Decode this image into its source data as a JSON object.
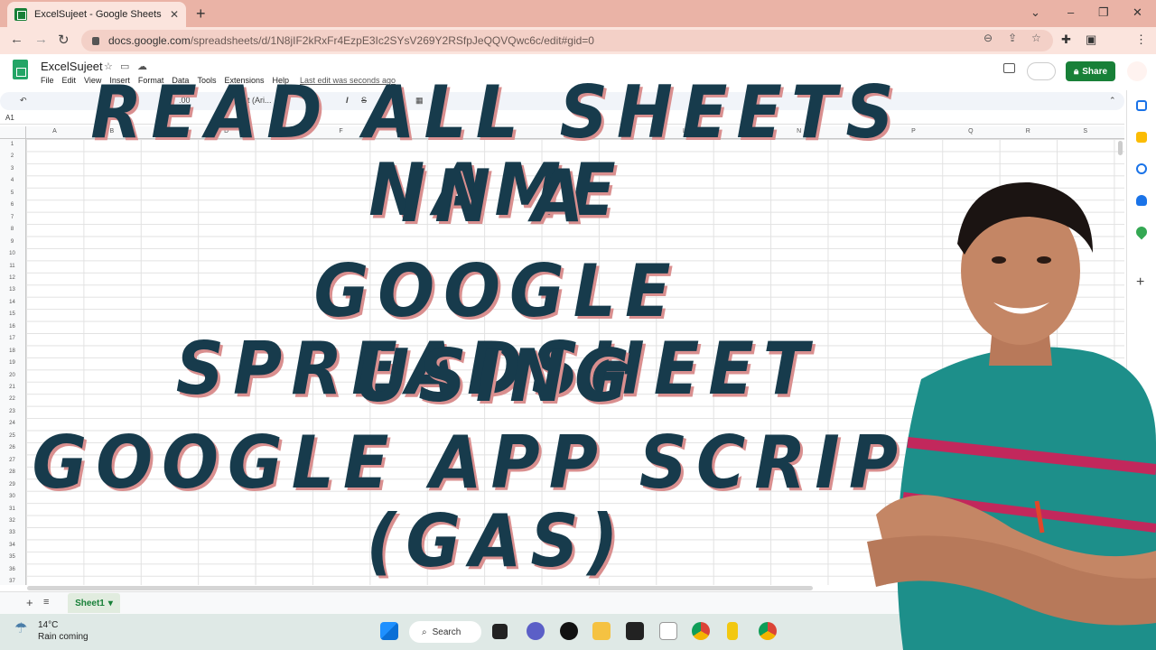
{
  "browser": {
    "tab_title": "ExcelSujeet - Google Sheets",
    "url_host": "docs.google.com",
    "url_path": "/spreadsheets/d/1N8jIF2kRxFr4EzpE3Ic2SYsV269Y2RSfpJeQQVQwc6c/edit#gid=0"
  },
  "sheets": {
    "doc_name": "ExcelSujeet",
    "menu": [
      "File",
      "Edit",
      "View",
      "Insert",
      "Format",
      "Data",
      "Tools",
      "Extensions",
      "Help"
    ],
    "last_edit": "Last edit was seconds ago",
    "share_label": "Share",
    "cell_ref": "A1",
    "font_name": "Default (Ari...",
    "columns": [
      "A",
      "B",
      "C",
      "D",
      "E",
      "F",
      "G",
      "H",
      "I",
      "J",
      "K",
      "L",
      "M",
      "N",
      "O",
      "P",
      "Q",
      "R",
      "S"
    ],
    "rows": [
      "1",
      "2",
      "3",
      "4",
      "5",
      "6",
      "7",
      "8",
      "9",
      "10",
      "11",
      "12",
      "13",
      "14",
      "15",
      "16",
      "17",
      "18",
      "19",
      "20",
      "21",
      "22",
      "23",
      "24",
      "25",
      "26",
      "27",
      "28",
      "29",
      "30",
      "31",
      "32",
      "33",
      "34",
      "35",
      "36",
      "37"
    ],
    "sheet_tab": "Sheet1"
  },
  "title_lines": [
    "READ ALL SHEETS NAME",
    "IN A",
    "GOOGLE SPREADSHEET",
    "USING",
    "GOOGLE APP SCRIPT",
    "(GAS)"
  ],
  "taskbar": {
    "temperature": "14°C",
    "weather": "Rain coming",
    "search_label": "Search"
  },
  "colors": {
    "title_text": "#173b4c",
    "title_shadow": "#d98f8f",
    "share_green": "#188038",
    "tabbar": "#eab3a6"
  }
}
